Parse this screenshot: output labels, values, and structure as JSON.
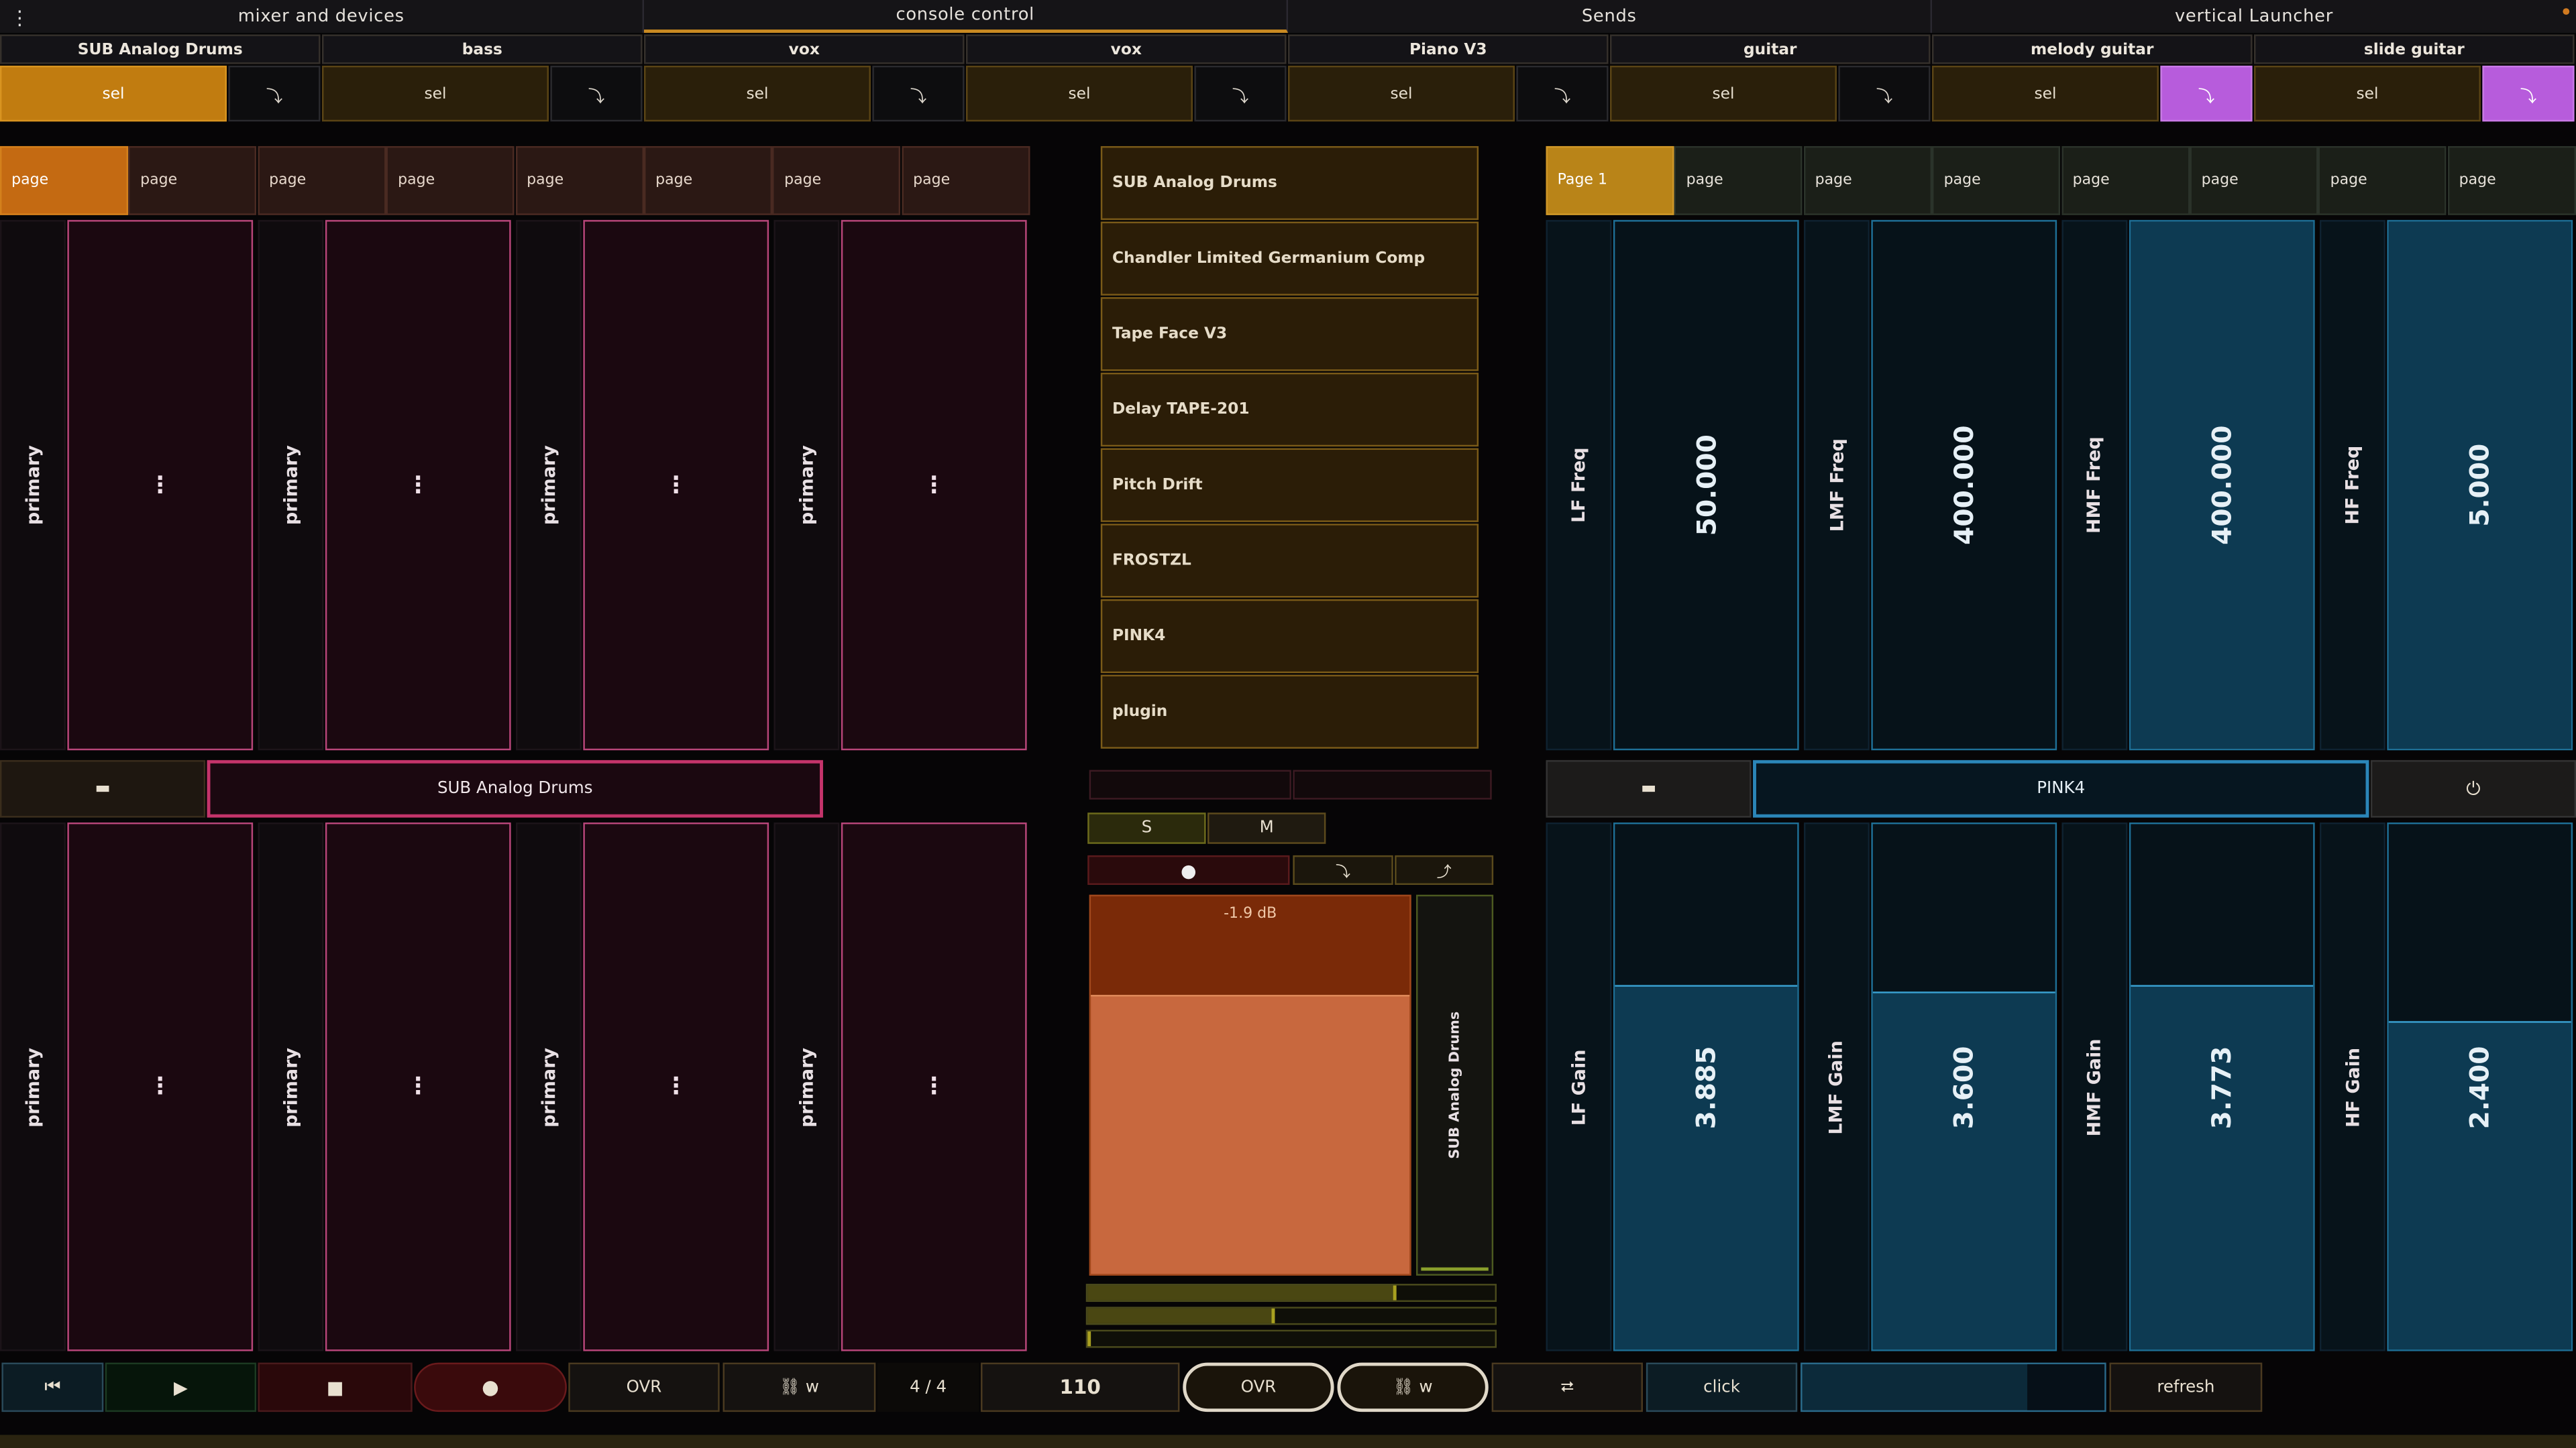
{
  "top_tabs": [
    "mixer and devices",
    "console control",
    "Sends",
    "vertical Launcher"
  ],
  "menu_icon": "⋮",
  "tracks": [
    {
      "name": "SUB Analog Drums",
      "sel": "sel",
      "arrow": "⤵"
    },
    {
      "name": "bass",
      "sel": "sel",
      "arrow": "⤵"
    },
    {
      "name": "vox",
      "sel": "sel",
      "arrow": "⤵"
    },
    {
      "name": "vox",
      "sel": "sel",
      "arrow": "⤵"
    },
    {
      "name": "Piano V3",
      "sel": "sel",
      "arrow": "⤵"
    },
    {
      "name": "guitar",
      "sel": "sel",
      "arrow": "⤵"
    },
    {
      "name": "melody guitar",
      "sel": "sel",
      "arrow": "⤵"
    },
    {
      "name": "slide guitar",
      "sel": "sel",
      "arrow": "⤵"
    }
  ],
  "left_pages": [
    "page",
    "page",
    "page",
    "page",
    "page",
    "page",
    "page",
    "page"
  ],
  "right_pages": [
    "Page 1",
    "page",
    "page",
    "page",
    "page",
    "page",
    "page",
    "page"
  ],
  "left_macros": {
    "label": "primary",
    "value": "⋮"
  },
  "devices": [
    "SUB Analog Drums",
    "Chandler Limited Germanium Comp",
    "Tape Face V3",
    "Delay TAPE-201",
    "Pitch Drift",
    "FROSTZL",
    "PINK4",
    "plugin"
  ],
  "left_track_bar": {
    "icon": "▬",
    "name": "SUB Analog Drums"
  },
  "right_device_bar": {
    "icon": "▬",
    "name": "PINK4",
    "power_icon": "⏻"
  },
  "eq_top": [
    {
      "label": "LF Freq",
      "value": "50.000",
      "level": 0.0
    },
    {
      "label": "LMF Freq",
      "value": "400.000",
      "level": 0.0
    },
    {
      "label": "HMF Freq",
      "value": "400.000",
      "level": 1.0
    },
    {
      "label": "HF Freq",
      "value": "5.000",
      "level": 1.0
    }
  ],
  "eq_bottom": [
    {
      "label": "LF Gain",
      "value": "3.885",
      "level": 0.695
    },
    {
      "label": "LMF Gain",
      "value": "3.600",
      "level": 0.68
    },
    {
      "label": "HMF Gain",
      "value": "3.773",
      "level": 0.695
    },
    {
      "label": "HF Gain",
      "value": "2.400",
      "level": 0.625
    }
  ],
  "channel": {
    "solo": "S",
    "mute": "M",
    "rec_icon": "●",
    "in_arrow": "⤵",
    "out_arrow": "⤴",
    "volume_db": "-1.9 dB",
    "volume_level": 0.74,
    "track_label": "SUB Analog Drums",
    "meter_levels": [
      0.76,
      0.46,
      0.0
    ]
  },
  "transport": {
    "rewind_icon": "⏮",
    "play_icon": "▶",
    "stop_icon": "■",
    "record_icon": "●",
    "ovr": "OVR",
    "link_w": "⛓ w",
    "time_sig": "4 / 4",
    "tempo": "110",
    "ovr2": "OVR",
    "link_w2": "⛓ w",
    "loop_icon": "⮂",
    "click": "click",
    "refresh": "refresh"
  },
  "colors": {
    "accent_orange": "#c17c10",
    "pad_pink": "#b8467a",
    "eq_blue": "#1e6f96",
    "purple": "#b75cdc"
  }
}
